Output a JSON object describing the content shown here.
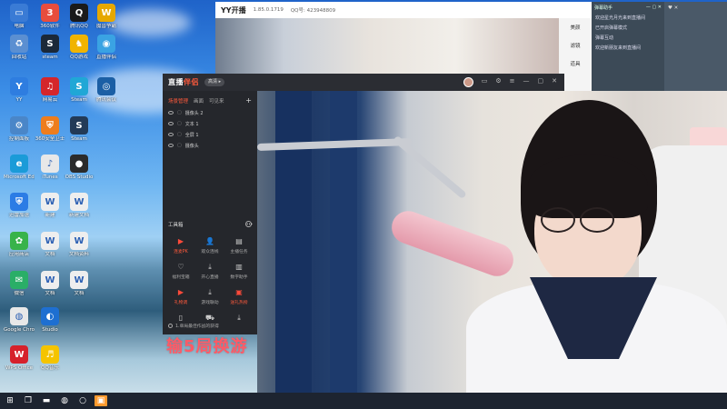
{
  "desktop": {
    "icons": [
      {
        "label": "电脑",
        "icon": "pc-icon",
        "color": "#3a7bd5",
        "glyph": "▭",
        "col": 0,
        "row": 0
      },
      {
        "label": "360软件",
        "icon": "360-icon",
        "color": "#e84d3d",
        "glyph": "3",
        "col": 1,
        "row": 0
      },
      {
        "label": "腾讯QQ",
        "icon": "qq-icon",
        "color": "#1a1a1a",
        "glyph": "Q",
        "col": 2,
        "row": 0
      },
      {
        "label": "魔兽争霸",
        "icon": "warcraft-icon",
        "color": "#e6a800",
        "glyph": "W",
        "col": 3,
        "row": 0
      },
      {
        "label": "回收站",
        "icon": "recycle-bin-icon",
        "color": "#5b8fd1",
        "glyph": "♻",
        "col": 0,
        "row": 1
      },
      {
        "label": "steam",
        "icon": "steam-icon",
        "color": "#1b2838",
        "glyph": "S",
        "col": 1,
        "row": 1
      },
      {
        "label": "QQ游戏",
        "icon": "qq-game-icon",
        "color": "#f0b400",
        "glyph": "♞",
        "col": 2,
        "row": 1
      },
      {
        "label": "直播伴侣",
        "icon": "broadcast-icon",
        "color": "#3aa3e3",
        "glyph": "◉",
        "col": 3,
        "row": 1
      },
      {
        "label": "YY",
        "icon": "yy-icon",
        "color": "#2e7de0",
        "glyph": "Y",
        "col": 0,
        "row": 2
      },
      {
        "label": "网易云",
        "icon": "netease-music-icon",
        "color": "#d4262b",
        "glyph": "♫",
        "col": 1,
        "row": 2
      },
      {
        "label": "Steam",
        "icon": "steam-app-icon",
        "color": "#20a7d6",
        "glyph": "S",
        "col": 2,
        "row": 2
      },
      {
        "label": "腾讯会议",
        "icon": "tencent-meeting-icon",
        "color": "#1b5fa5",
        "glyph": "◎",
        "col": 3,
        "row": 2
      },
      {
        "label": "控制面板",
        "icon": "control-panel-icon",
        "color": "#4a86c8",
        "glyph": "⚙",
        "col": 0,
        "row": 3
      },
      {
        "label": "360安全卫士",
        "icon": "security-icon",
        "color": "#ee7d1d",
        "glyph": "⛨",
        "col": 1,
        "row": 3
      },
      {
        "label": "Steam",
        "icon": "steam-logo-icon",
        "color": "#233a57",
        "glyph": "S",
        "col": 2,
        "row": 3
      },
      {
        "label": "Microsoft Edge",
        "icon": "edge-icon",
        "color": "#1b9bd8",
        "glyph": "e",
        "col": 0,
        "row": 4
      },
      {
        "label": "iTunes",
        "icon": "itunes-icon",
        "color": "#e8e8e8",
        "glyph": "♪",
        "col": 1,
        "row": 4
      },
      {
        "label": "OBS Studio",
        "icon": "obs-icon",
        "color": "#2b2b2b",
        "glyph": "●",
        "col": 2,
        "row": 4
      },
      {
        "label": "迅雷加速",
        "icon": "accelerator-icon",
        "color": "#2c7ce5",
        "glyph": "⛨",
        "col": 0,
        "row": 5
      },
      {
        "label": "新建",
        "icon": "word-doc-icon",
        "color": "#eeeeee",
        "glyph": "W",
        "col": 1,
        "row": 5
      },
      {
        "label": "新建文档",
        "icon": "word-doc2-icon",
        "color": "#eeeeee",
        "glyph": "W",
        "col": 2,
        "row": 5
      },
      {
        "label": "应用商店",
        "icon": "app-store-icon",
        "color": "#38b34a",
        "glyph": "✿",
        "col": 0,
        "row": 6
      },
      {
        "label": "文档",
        "icon": "word-doc3-icon",
        "color": "#eeeeee",
        "glyph": "W",
        "col": 1,
        "row": 6
      },
      {
        "label": "文档资料",
        "icon": "word-doc4-icon",
        "color": "#eeeeee",
        "glyph": "W",
        "col": 2,
        "row": 6
      },
      {
        "label": "微信",
        "icon": "wechat-icon",
        "color": "#2aae67",
        "glyph": "✉",
        "col": 0,
        "row": 7
      },
      {
        "label": "文档",
        "icon": "word-doc5-icon",
        "color": "#eeeeee",
        "glyph": "W",
        "col": 1,
        "row": 7
      },
      {
        "label": "文档",
        "icon": "word-doc6-icon",
        "color": "#eeeeee",
        "glyph": "W",
        "col": 2,
        "row": 7
      },
      {
        "label": "Google Chrome",
        "icon": "chrome-icon",
        "color": "#e8e8e8",
        "glyph": "◍",
        "col": 0,
        "row": 8
      },
      {
        "label": "Studio",
        "icon": "studio-icon",
        "color": "#1e6fd1",
        "glyph": "◐",
        "col": 1,
        "row": 8
      },
      {
        "label": "WPS Office",
        "icon": "wps-icon",
        "color": "#d6212b",
        "glyph": "W",
        "col": 0,
        "row": 9
      },
      {
        "label": "QQ音乐",
        "icon": "qq-music-icon",
        "color": "#f5c400",
        "glyph": "♬",
        "col": 1,
        "row": 9
      }
    ]
  },
  "taskbar": {
    "items": [
      {
        "name": "start-icon",
        "glyph": "⊞",
        "active": false
      },
      {
        "name": "task-view-icon",
        "glyph": "❐",
        "active": false
      },
      {
        "name": "file-explorer-icon",
        "glyph": "▬",
        "active": false
      },
      {
        "name": "chrome-taskbar-icon",
        "glyph": "◍",
        "active": false
      },
      {
        "name": "ring-app-icon",
        "glyph": "○",
        "active": false
      },
      {
        "name": "live-app-taskbar-icon",
        "glyph": "▣",
        "active": true
      }
    ]
  },
  "yy": {
    "app_name": "YY开播",
    "version": "1.85.0.1719",
    "qq": "QQ号: 423948809",
    "side": [
      "美颜",
      "滤镜",
      "道具"
    ],
    "panel_rows": [
      "弹幕助手",
      "欢迎星光月光来到直播间",
      "已开启弹幕模式",
      "弹幕互动",
      "欢迎新朋友来到直播间"
    ]
  },
  "live": {
    "logo_a": "直播",
    "logo_b": "伴侣",
    "badge": "高清 ▸",
    "tabs": [
      "场景管理",
      "画面",
      "可见来"
    ],
    "scenes": [
      "摄像头 2",
      "文本 1",
      "全屏 1",
      "摄像头"
    ],
    "tools_title": "工具箱",
    "tools": [
      {
        "label": "连麦PK",
        "glyph": "▶",
        "red": true,
        "name": "link-pk-icon"
      },
      {
        "label": "观众连线",
        "glyph": "👤",
        "red": false,
        "name": "audience-link-icon"
      },
      {
        "label": "主播任务",
        "glyph": "▤",
        "red": false,
        "name": "anchor-task-icon"
      },
      {
        "label": "福利宝箱",
        "glyph": "♡",
        "red": false,
        "name": "gift-box-icon"
      },
      {
        "label": "开心直播",
        "glyph": "⤓",
        "red": false,
        "name": "happy-live-icon"
      },
      {
        "label": "数字助手",
        "glyph": "▥",
        "red": false,
        "name": "digital-assistant-icon"
      },
      {
        "label": "礼物调",
        "glyph": "▶",
        "red": true,
        "name": "gift-tune-icon"
      },
      {
        "label": "游戏联动",
        "glyph": "⤓",
        "red": false,
        "name": "game-link-icon"
      },
      {
        "label": "送礼热榜",
        "glyph": "▣",
        "red": true,
        "name": "gift-rank-icon"
      },
      {
        "label": "",
        "glyph": "▯",
        "red": false,
        "name": "screen-icon"
      },
      {
        "label": "",
        "glyph": "⛟",
        "red": false,
        "name": "vehicle-icon"
      },
      {
        "label": "",
        "glyph": "⤓",
        "red": false,
        "name": "download-icon"
      }
    ],
    "notice": "1.单局最佳作战的获得"
  },
  "overlay_text": "输5局换游"
}
